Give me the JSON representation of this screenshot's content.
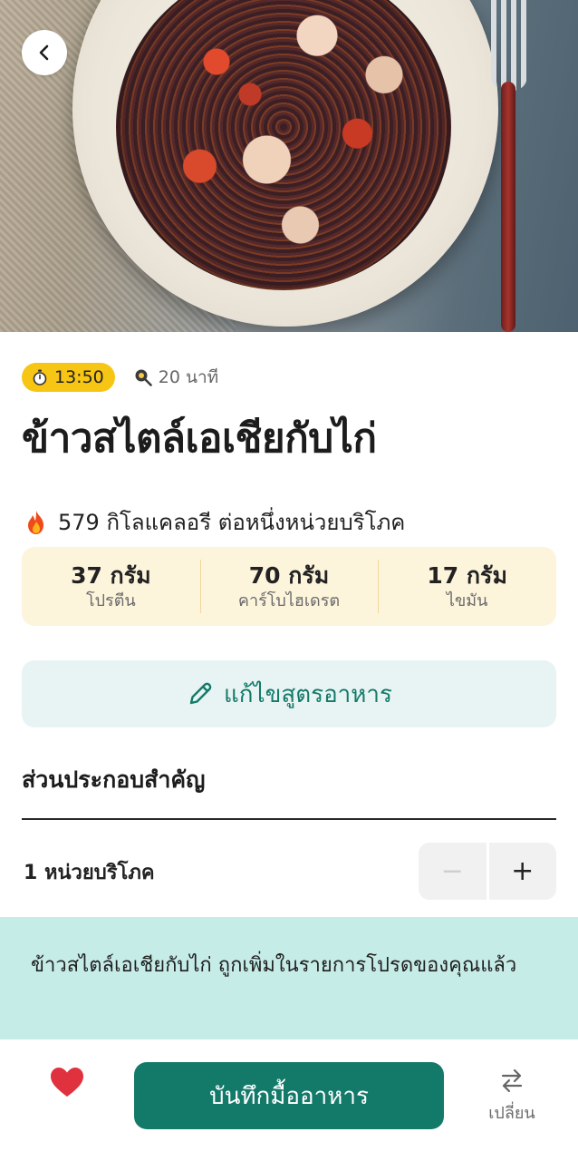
{
  "recipe": {
    "timer": "13:50",
    "cook_time": "20 นาที",
    "title": "ข้าวสไตล์เอเชียกับไก่",
    "calories": "579 กิโลแคลอรี ต่อหนึ่งหน่วยบริโภค",
    "macros": [
      {
        "value": "37 กรัม",
        "label": "โปรตีน"
      },
      {
        "value": "70 กรัม",
        "label": "คาร์โบไฮเดรต"
      },
      {
        "value": "17 กรัม",
        "label": "ไขมัน"
      }
    ]
  },
  "actions": {
    "edit_label": "แก้ไขสูตรอาหาร"
  },
  "ingredients": {
    "section_title": "ส่วนประกอบสำคัญ",
    "servings_label": "1 หน่วยบริโภค",
    "stepper_minus": "−",
    "stepper_plus": "+"
  },
  "toast": {
    "message": "ข้าวสไตล์เอเชียกับไก่ ถูกเพิ่มในรายการโปรดของคุณแล้ว"
  },
  "bottom_bar": {
    "log_label": "บันทึกมื้ออาหาร",
    "swap_label": "เปลี่ยน"
  },
  "colors": {
    "accent": "#137a6a",
    "timer_pill": "#f7c514",
    "macros_bg": "#fdf4dc",
    "toast_bg": "#c6ece8",
    "favorite": "#e0313f"
  },
  "icons": {
    "back": "chevron-left-icon",
    "timer": "stopwatch-icon",
    "cook_time": "frying-pan-icon",
    "calories": "fire-icon",
    "edit": "pencil-icon",
    "favorite": "heart-icon",
    "swap": "swap-arrows-icon"
  }
}
